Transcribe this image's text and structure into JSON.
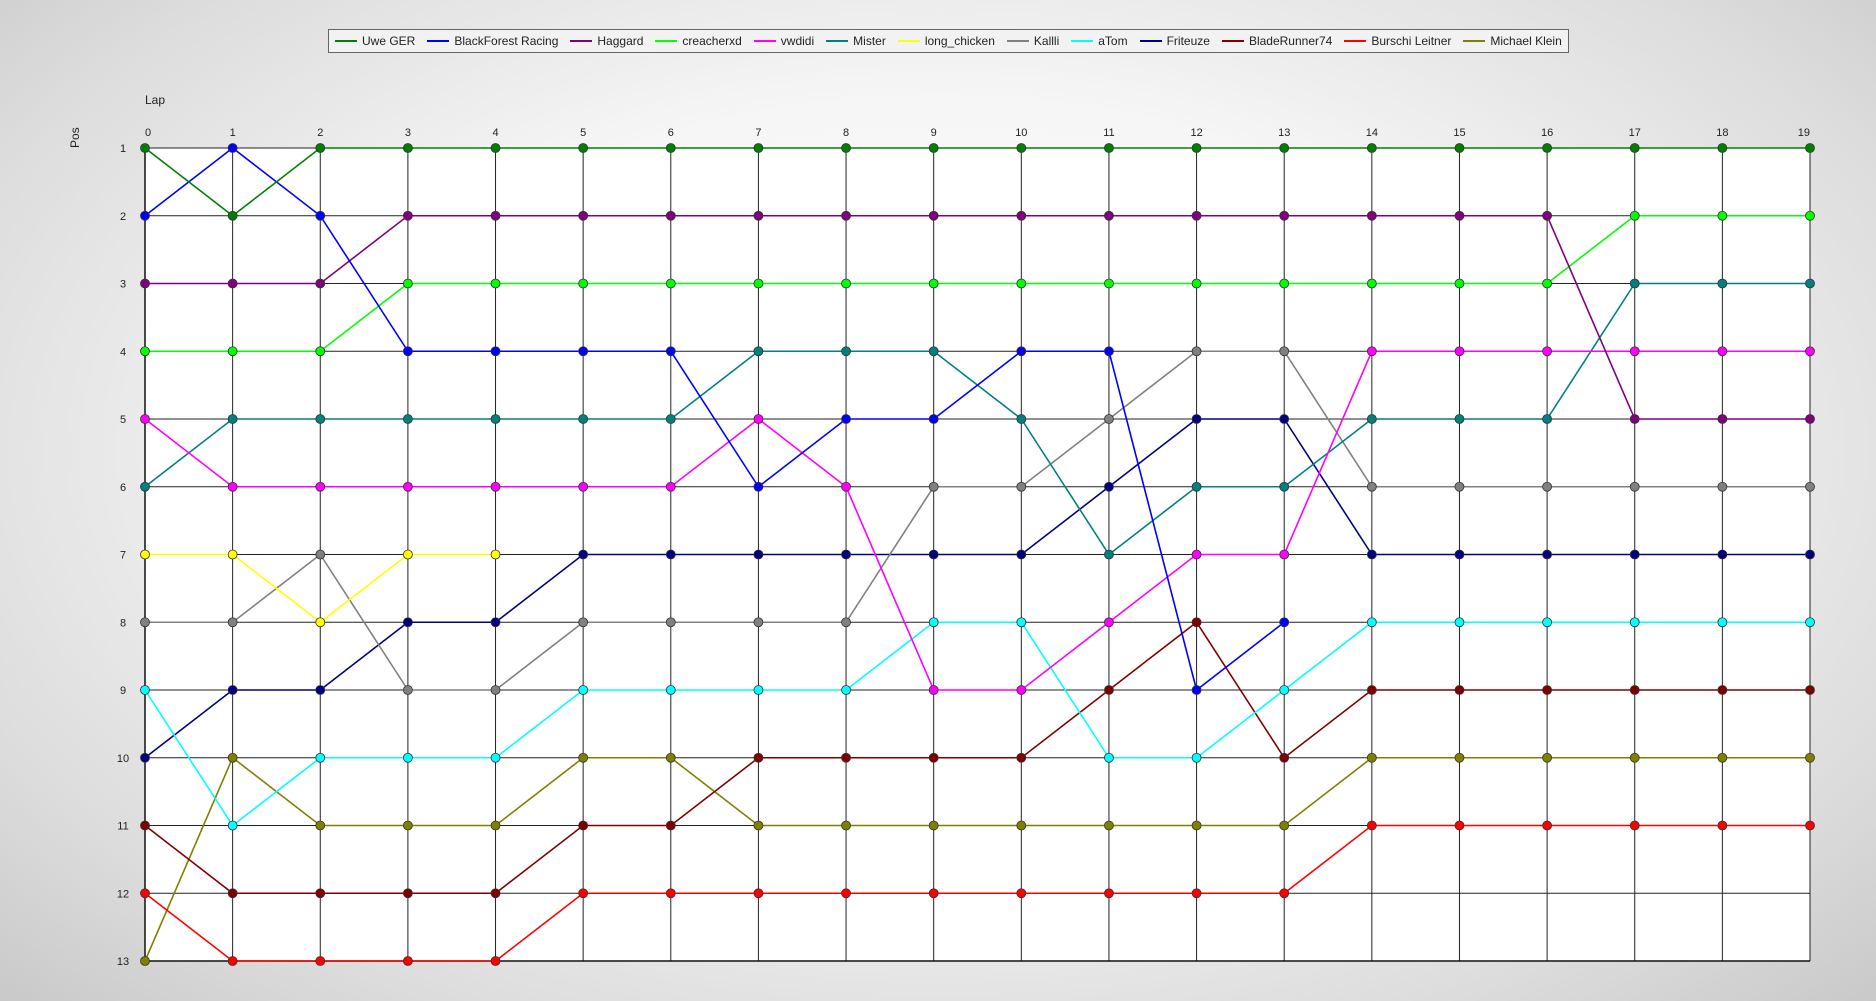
{
  "chart_data": {
    "type": "line",
    "xlabel": "Lap",
    "ylabel": "Pos",
    "x": [
      0,
      1,
      2,
      3,
      4,
      5,
      6,
      7,
      8,
      9,
      10,
      11,
      12,
      13,
      14,
      15,
      16,
      17,
      18,
      19
    ],
    "y_ticks": [
      1,
      2,
      3,
      4,
      5,
      6,
      7,
      8,
      9,
      10,
      11,
      12,
      13
    ],
    "ylim": [
      1,
      13
    ],
    "xlim": [
      0,
      19
    ],
    "y_inverted": true,
    "grid": true,
    "legend_position": "top",
    "series": [
      {
        "name": "Uwe GER",
        "color": "#008000",
        "values": [
          1,
          2,
          1,
          1,
          1,
          1,
          1,
          1,
          1,
          1,
          1,
          1,
          1,
          1,
          1,
          1,
          1,
          1,
          1,
          1
        ]
      },
      {
        "name": "BlackForest Racing",
        "color": "#0000ff",
        "values": [
          2,
          1,
          2,
          4,
          4,
          4,
          4,
          6,
          5,
          5,
          4,
          4,
          9,
          8,
          null,
          null,
          null,
          null,
          null,
          null
        ]
      },
      {
        "name": "Haggard",
        "color": "#800080",
        "values": [
          3,
          3,
          3,
          2,
          2,
          2,
          2,
          2,
          2,
          2,
          2,
          2,
          2,
          2,
          2,
          2,
          2,
          5,
          5,
          5
        ]
      },
      {
        "name": "creacherxd",
        "color": "#00ff00",
        "values": [
          4,
          4,
          4,
          3,
          3,
          3,
          3,
          3,
          3,
          3,
          3,
          3,
          3,
          3,
          3,
          3,
          3,
          2,
          2,
          2
        ]
      },
      {
        "name": "vwdidi",
        "color": "#ff00ff",
        "values": [
          5,
          6,
          6,
          6,
          6,
          6,
          6,
          5,
          6,
          9,
          9,
          8,
          7,
          7,
          4,
          4,
          4,
          4,
          4,
          4
        ]
      },
      {
        "name": "Mister",
        "color": "#008080",
        "values": [
          6,
          5,
          5,
          5,
          5,
          5,
          5,
          4,
          4,
          4,
          5,
          7,
          6,
          6,
          5,
          5,
          5,
          3,
          3,
          3
        ]
      },
      {
        "name": "long_chicken",
        "color": "#ffff00",
        "values": [
          7,
          7,
          8,
          7,
          7,
          null,
          null,
          null,
          null,
          null,
          null,
          null,
          null,
          null,
          null,
          null,
          null,
          null,
          null,
          null
        ]
      },
      {
        "name": "Kallli",
        "color": "#808080",
        "values": [
          8,
          8,
          7,
          9,
          9,
          8,
          8,
          8,
          8,
          6,
          6,
          5,
          4,
          4,
          6,
          6,
          6,
          6,
          6,
          6
        ]
      },
      {
        "name": "aTom",
        "color": "#00ffff",
        "values": [
          9,
          11,
          10,
          10,
          10,
          9,
          9,
          9,
          9,
          8,
          8,
          10,
          10,
          9,
          8,
          8,
          8,
          8,
          8,
          8
        ]
      },
      {
        "name": "Friteuze",
        "color": "#000080",
        "values": [
          10,
          9,
          9,
          8,
          8,
          7,
          7,
          7,
          7,
          7,
          7,
          6,
          5,
          5,
          7,
          7,
          7,
          7,
          7,
          7
        ]
      },
      {
        "name": "BladeRunner74",
        "color": "#800000",
        "values": [
          11,
          12,
          12,
          12,
          12,
          11,
          11,
          10,
          10,
          10,
          10,
          9,
          8,
          10,
          9,
          9,
          9,
          9,
          9,
          9
        ]
      },
      {
        "name": "Burschi Leitner",
        "color": "#ff0000",
        "values": [
          12,
          13,
          13,
          13,
          13,
          12,
          12,
          12,
          12,
          12,
          12,
          12,
          12,
          12,
          11,
          11,
          11,
          11,
          11,
          11
        ]
      },
      {
        "name": "Michael Klein",
        "color": "#808000",
        "values": [
          13,
          10,
          11,
          11,
          11,
          10,
          10,
          11,
          11,
          11,
          11,
          11,
          11,
          11,
          10,
          10,
          10,
          10,
          10,
          10
        ]
      }
    ]
  }
}
